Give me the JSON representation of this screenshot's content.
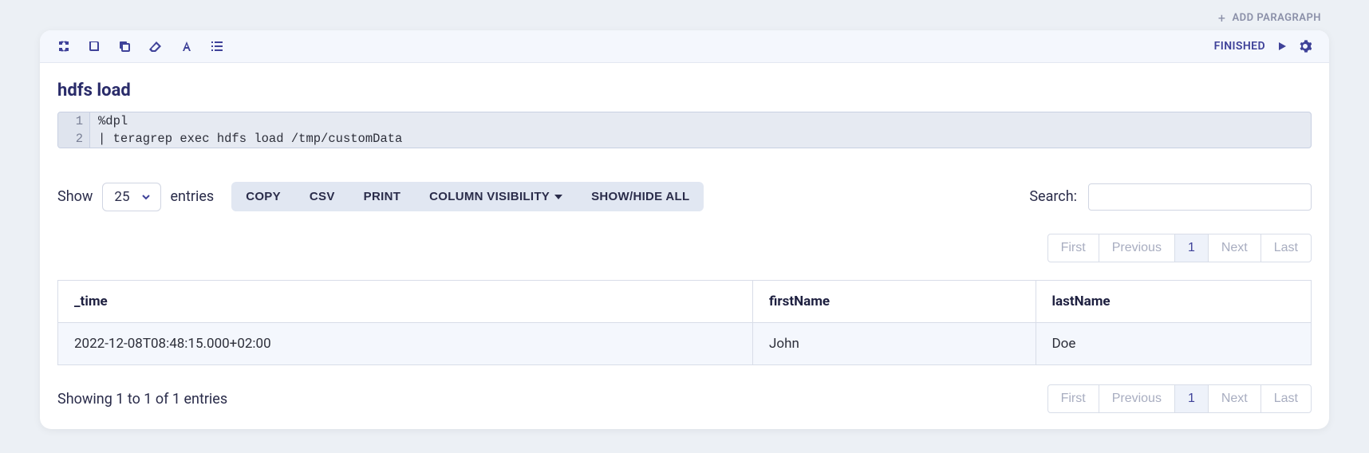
{
  "toolbar": {
    "add_paragraph": "ADD PARAGRAPH",
    "status": "FINISHED"
  },
  "title": "hdfs load",
  "code": {
    "lines": [
      {
        "num": "1",
        "text": "%dpl"
      },
      {
        "num": "2",
        "text": "| teragrep exec hdfs load /tmp/customData"
      }
    ]
  },
  "controls": {
    "show_label": "Show",
    "entries_label": "entries",
    "page_size": "25",
    "buttons": {
      "copy": "COPY",
      "csv": "CSV",
      "print": "PRINT",
      "colvis": "COLUMN VISIBILITY",
      "showhide": "SHOW/HIDE ALL"
    },
    "search_label": "Search:"
  },
  "pagination": {
    "first": "First",
    "previous": "Previous",
    "page": "1",
    "next": "Next",
    "last": "Last"
  },
  "table": {
    "headers": {
      "time": "_time",
      "firstName": "firstName",
      "lastName": "lastName"
    },
    "rows": [
      {
        "time": "2022-12-08T08:48:15.000+02:00",
        "firstName": "John",
        "lastName": "Doe"
      }
    ]
  },
  "footer": {
    "showing": "Showing 1 to 1 of 1 entries"
  }
}
